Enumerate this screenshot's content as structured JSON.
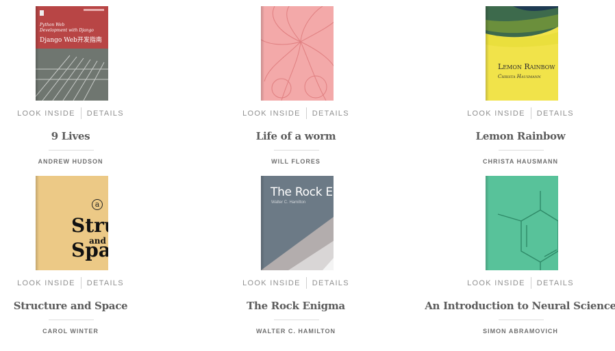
{
  "colors": {
    "action_text": "#8f8f8f",
    "title_text": "#5c5c5c",
    "author_text": "#6e6e6e",
    "divider": "#dddddd"
  },
  "books": [
    {
      "title": "9 Lives",
      "author": "ANDREW HUDSON",
      "look_inside": "LOOK INSIDE",
      "details": "DETAILS",
      "cover": {
        "style": "red",
        "lines": [
          "Python Web",
          "Development with Django",
          "Django Web开发指南"
        ]
      }
    },
    {
      "title": "Life of a worm",
      "author": "WILL FLORES",
      "look_inside": "LOOK INSIDE",
      "details": "DETAILS",
      "cover": {
        "style": "pink-petals",
        "lines": []
      }
    },
    {
      "title": "Lemon Rainbow",
      "author": "CHRISTA HAUSMANN",
      "look_inside": "LOOK INSIDE",
      "details": "DETAILS",
      "cover": {
        "style": "yellow",
        "lines": [
          "Lemon Rainbow",
          "Christa Hausmann"
        ]
      }
    },
    {
      "title": "Structure and Space",
      "author": "CAROL WINTER",
      "look_inside": "LOOK INSIDE",
      "details": "DETAILS",
      "cover": {
        "style": "tan",
        "lines": [
          "a",
          "Struct",
          "and",
          "Spac"
        ]
      }
    },
    {
      "title": "The Rock Enigma",
      "author": "WALTER C. HAMILTON",
      "look_inside": "LOOK INSIDE",
      "details": "DETAILS",
      "cover": {
        "style": "slate",
        "lines": [
          "The Rock Enig",
          "Walter C. Hamilton"
        ]
      }
    },
    {
      "title": "An Introduction to Neural Science",
      "author": "SIMON ABRAMOVICH",
      "look_inside": "LOOK INSIDE",
      "details": "DETAILS",
      "cover": {
        "style": "teal-molecule",
        "lines": []
      }
    }
  ]
}
